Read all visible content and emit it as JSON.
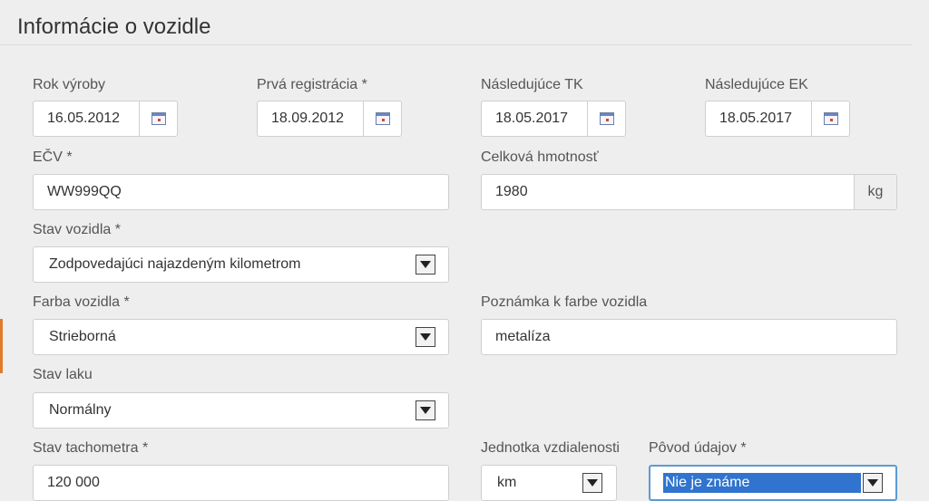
{
  "section": {
    "title": "Informácie o vozidle"
  },
  "fields": {
    "rok_vyroby": {
      "label": "Rok výroby",
      "value": "16.05.2012"
    },
    "prva_registracia": {
      "label": "Prvá registrácia *",
      "value": "18.09.2012"
    },
    "nasledujuce_tk": {
      "label": "Následujúce TK",
      "value": "18.05.2017"
    },
    "nasledujuce_ek": {
      "label": "Následujúce EK",
      "value": "18.05.2017"
    },
    "ecv": {
      "label": "EČV *",
      "value": "WW999QQ"
    },
    "celkova_hmotnost": {
      "label": "Celková hmotnosť",
      "value": "1980",
      "unit": "kg"
    },
    "stav_vozidla": {
      "label": "Stav vozidla *",
      "value": "Zodpovedajúci najazdeným kilometrom"
    },
    "farba_vozidla": {
      "label": "Farba vozidla *",
      "value": "Strieborná"
    },
    "poznamka_farba": {
      "label": "Poznámka k farbe vozidla",
      "value": "metalíza"
    },
    "stav_laku": {
      "label": "Stav laku",
      "value": "Normálny"
    },
    "stav_tachometra": {
      "label": "Stav tachometra *",
      "value": "120 000"
    },
    "jednotka_vzdialenosti": {
      "label": "Jednotka vzdialenosti",
      "value": "km"
    },
    "povod_udajov": {
      "label": "Pôvod údajov *",
      "value": "Nie je známe"
    }
  },
  "icons": {
    "date_picker": "calendar-icon",
    "select": "chevron-down-icon"
  },
  "colors": {
    "accent": "#e07b2a",
    "focus_border": "#5b9bd5",
    "selection": "#3074d0"
  }
}
